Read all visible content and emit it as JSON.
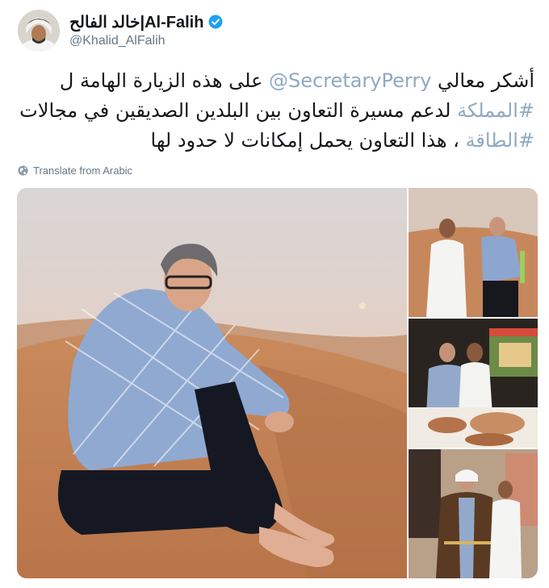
{
  "header": {
    "display_name": "خالد الفالح|Al-Falih",
    "handle": "@Khalid_AlFalih",
    "verified_icon": "verified-badge-icon",
    "avatar_icon": "profile-avatar"
  },
  "tweet": {
    "line1_pre": "أشكر معالي ",
    "line1_mention": "@SecretaryPerry",
    "line1_post": " على هذه الزيارة الهامة ل",
    "line2_hashtag": "#المملكة",
    "line2_post": " لدعم مسيرة التعاون بين البلدين الصديقين في مجالات",
    "line3_hashtag": "#الطاقة",
    "line3_post": " ، هذا التعاون يحمل إمكانات لا حدود لها"
  },
  "translate": {
    "label": "Translate from Arabic",
    "icon": "globe-icon"
  },
  "colors": {
    "link": "#8fa9c1",
    "verified": "#1da1f2",
    "muted": "#657786"
  },
  "media": {
    "photos": [
      {
        "name": "main-photo",
        "icon": "photo-desert-man-sitting"
      },
      {
        "name": "photo-two-men-desert",
        "icon": "photo-two-men"
      },
      {
        "name": "photo-market-stall",
        "icon": "photo-food-stall"
      },
      {
        "name": "photo-traditional-robe",
        "icon": "photo-robe-ceremony"
      }
    ]
  }
}
